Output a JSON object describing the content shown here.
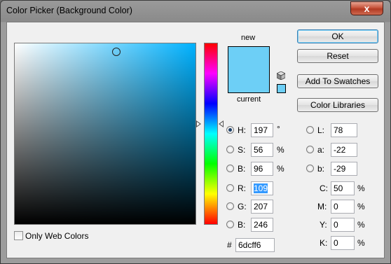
{
  "window": {
    "title": "Color Picker (Background Color)",
    "close_glyph": "x"
  },
  "colors": {
    "new": "#6dcff6",
    "current": "#6dcff6",
    "hue_pure": "#00b2ff"
  },
  "swatches": {
    "new_label": "new",
    "current_label": "current"
  },
  "buttons": {
    "ok": "OK",
    "reset": "Reset",
    "add_to_swatches": "Add To Swatches",
    "color_libraries": "Color Libraries"
  },
  "hsb": {
    "h": {
      "label": "H:",
      "value": "197",
      "unit": "°",
      "selected": true
    },
    "s": {
      "label": "S:",
      "value": "56",
      "unit": "%"
    },
    "b": {
      "label": "B:",
      "value": "96",
      "unit": "%"
    }
  },
  "rgb": {
    "r": {
      "label": "R:",
      "value": "109"
    },
    "g": {
      "label": "G:",
      "value": "207"
    },
    "b": {
      "label": "B:",
      "value": "246"
    }
  },
  "lab": {
    "l": {
      "label": "L:",
      "value": "78"
    },
    "a": {
      "label": "a:",
      "value": "-22"
    },
    "b": {
      "label": "b:",
      "value": "-29"
    }
  },
  "cmyk": {
    "c": {
      "label": "C:",
      "value": "50",
      "unit": "%"
    },
    "m": {
      "label": "M:",
      "value": "0",
      "unit": "%"
    },
    "y": {
      "label": "Y:",
      "value": "0",
      "unit": "%"
    },
    "k": {
      "label": "K:",
      "value": "0",
      "unit": "%"
    }
  },
  "hex": {
    "label": "#",
    "value": "6dcff6"
  },
  "web_colors": {
    "label": "Only Web Colors",
    "checked": false
  }
}
